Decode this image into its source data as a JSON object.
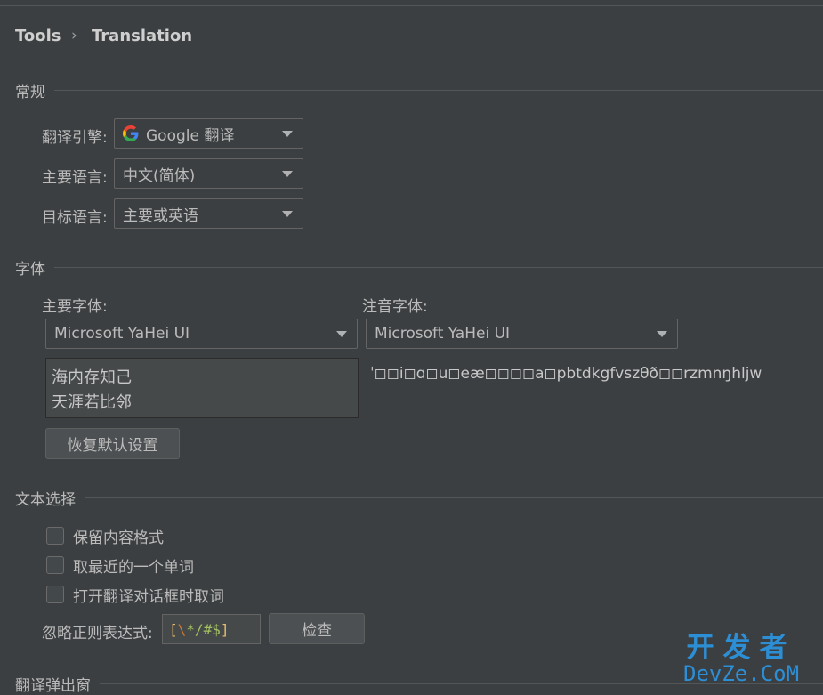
{
  "breadcrumb": {
    "parent": "Tools",
    "separator": "›",
    "current": "Translation"
  },
  "general": {
    "section_title": "常规",
    "engine_label": "翻译引擎:",
    "engine_value": "Google 翻译",
    "primary_lang_label": "主要语言:",
    "primary_lang_value": "中文(简体)",
    "target_lang_label": "目标语言:",
    "target_lang_value": "主要或英语"
  },
  "fonts": {
    "section_title": "字体",
    "primary_font_label": "主要字体:",
    "primary_font_value": "Microsoft YaHei UI",
    "phonetic_font_label": "注音字体:",
    "phonetic_font_value": "Microsoft YaHei UI",
    "preview_line1": "海内存知己",
    "preview_line2": "天涯若比邻",
    "phonetic_preview": "ˈ◻◻i◻ɑ◻u◻eæ◻◻◻◻a◻pbtdkgfvszθð◻◻rzmnŋhljw",
    "restore_button": "恢复默认设置"
  },
  "text_selection": {
    "section_title": "文本选择",
    "options": [
      "保留内容格式",
      "取最近的一个单词",
      "打开翻译对话框时取词"
    ],
    "ignore_regex_label": "忽略正则表达式:",
    "ignore_regex_value": "[\\*/#$]",
    "check_button": "检查"
  },
  "popup": {
    "section_title": "翻译弹出窗"
  },
  "watermark": {
    "cn": "开发者",
    "en": "DevZe.CoM"
  },
  "colors": {
    "background": "#3c3f41",
    "text": "#bbbbbb",
    "google_blue": "#4285F4",
    "google_red": "#EA4335",
    "google_yellow": "#FBBC05",
    "google_green": "#34A853",
    "watermark": "#2c8fd6"
  }
}
